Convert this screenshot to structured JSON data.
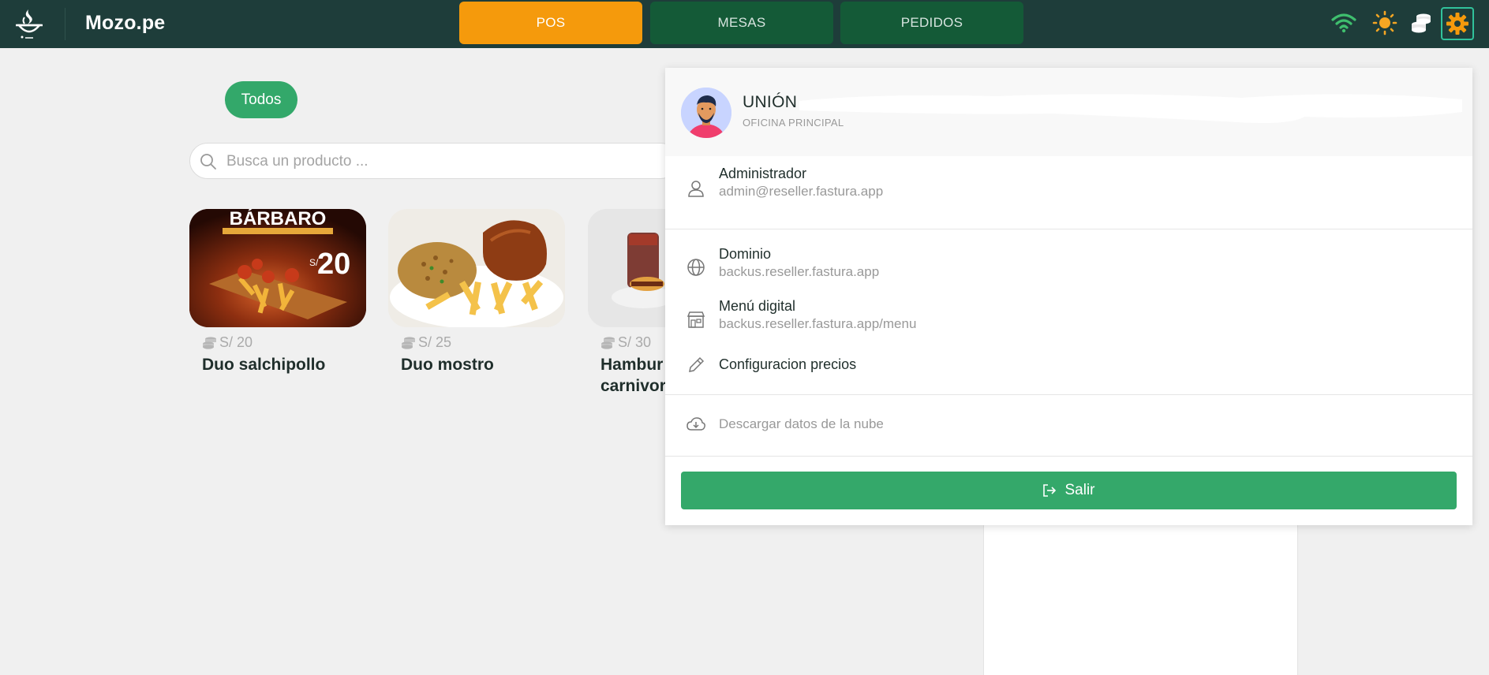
{
  "header": {
    "brand": "Mozo.pe",
    "tabs": [
      {
        "label": "POS"
      },
      {
        "label": "MESAS"
      },
      {
        "label": "PEDIDOS"
      }
    ],
    "accent_color": "#f59a0c",
    "bar_color": "#1e3d3a"
  },
  "filter": {
    "chip_label": "Todos"
  },
  "search": {
    "placeholder": "Busca un producto ..."
  },
  "products": [
    {
      "price": "S/ 20",
      "name": "Duo salchipollo",
      "image_text": "BÁRBARO"
    },
    {
      "price": "S/ 25",
      "name": "Duo mostro"
    },
    {
      "price": "S/ 30",
      "name_line1": "Hambur",
      "name_line2": "carnivor"
    }
  ],
  "menu": {
    "company": "UNIÓN",
    "branch": "OFICINA PRINCIPAL",
    "user_role": "Administrador",
    "user_email": "admin@reseller.fastura.app",
    "domain_label": "Dominio",
    "domain_value": "backus.reseller.fastura.app",
    "menu_label": "Menú digital",
    "menu_value": "backus.reseller.fastura.app/menu",
    "prices_label": "Configuracion precios",
    "download_label": "Descargar datos de la nube",
    "logout_label": "Salir"
  }
}
